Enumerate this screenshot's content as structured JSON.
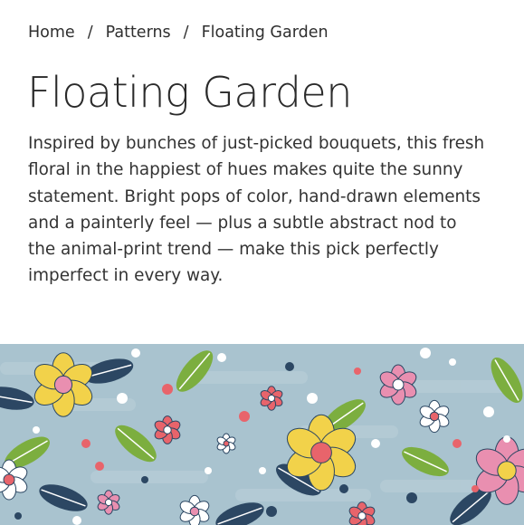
{
  "breadcrumb": {
    "home": "Home",
    "patterns": "Patterns",
    "current": "Floating Garden",
    "separator": "/"
  },
  "page": {
    "title": "Floating Garden",
    "description_lines": [
      "Inspired by bunches of just-picked bouquets, this fresh",
      "floral in the happiest of hues makes quite the sunny",
      "statement. Bright pops of color, hand-drawn elements",
      "and a painterly feel — plus a subtle abstract nod to",
      "the animal-print trend — make this pick perfectly",
      "imperfect in every way."
    ]
  },
  "pattern_swatch": {
    "background": "#a9c3cf",
    "colors": {
      "yellow": "#f2d24a",
      "pink": "#e98fb0",
      "coral": "#e8646b",
      "green": "#7cae3f",
      "navy": "#2c4763",
      "white": "#ffffff",
      "lilac": "#b8a4d6"
    }
  }
}
